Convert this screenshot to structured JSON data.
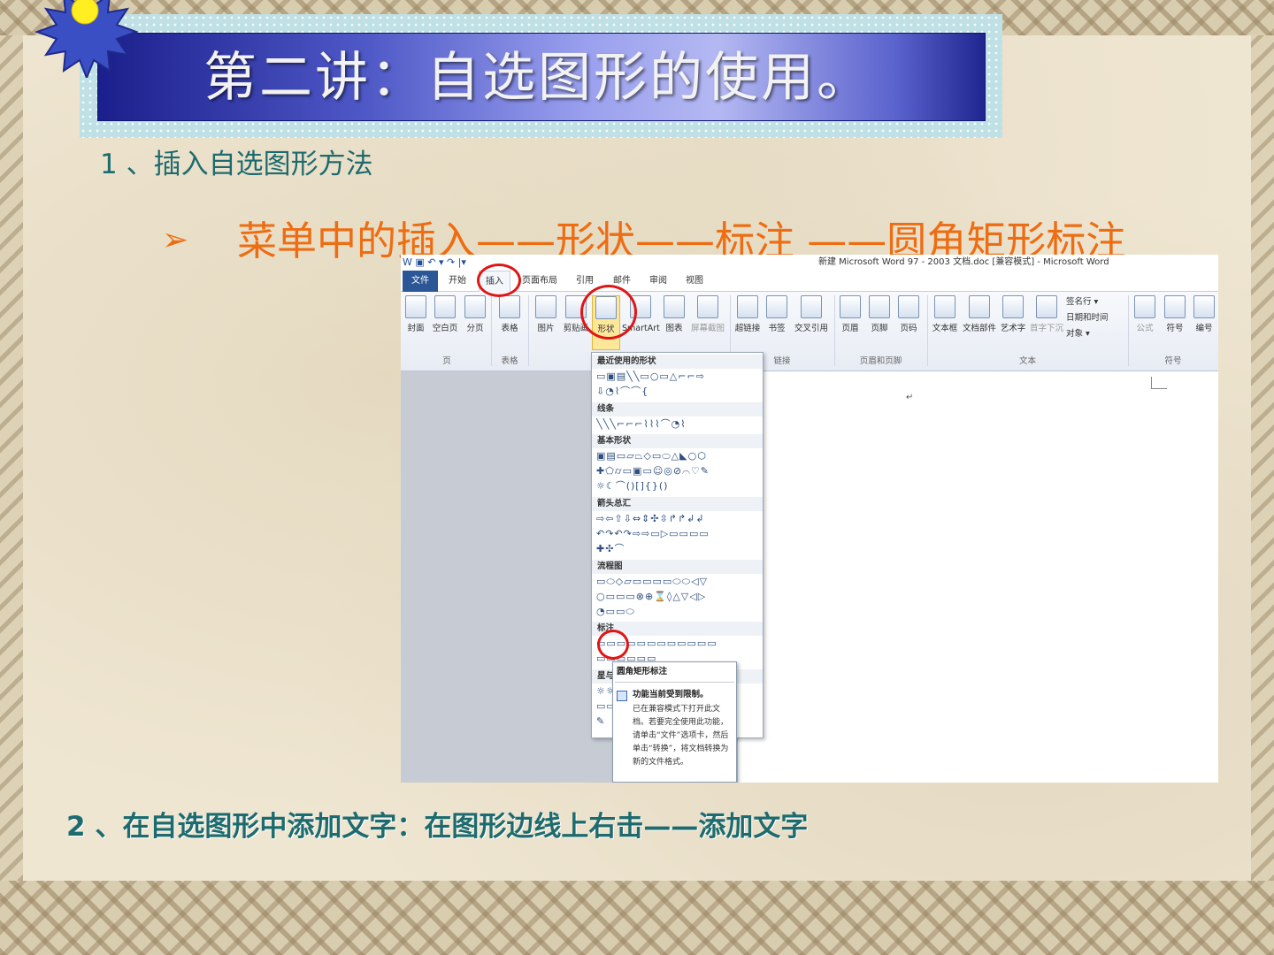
{
  "slide": {
    "title": "第二讲：自选图形的使用。",
    "heading1": "1 、插入自选图形方法",
    "bullet_marker": "➢",
    "bullet_text": "菜单中的插入——形状——标注 ——圆角矩形标注",
    "heading2": "2 、在自选图形中添加文字：在图形边线上右击——添加文字"
  },
  "word": {
    "window_title": "新建 Microsoft Word 97 - 2003 文档.doc [兼容模式] - Microsoft Word",
    "quick_access": "W  ▣  ↶ ▾  ↷  |▾",
    "tabs": [
      "文件",
      "开始",
      "插入",
      "页面布局",
      "引用",
      "邮件",
      "审阅",
      "视图"
    ],
    "active_tab": "插入",
    "ribbon_buttons": [
      "封面",
      "空白页",
      "分页",
      "表格",
      "图片",
      "剪贴画",
      "形状",
      "SmartArt",
      "图表",
      "屏幕截图",
      "超链接",
      "书签",
      "交叉引用",
      "页眉",
      "页脚",
      "页码",
      "文本框",
      "文档部件",
      "艺术字",
      "首字下沉",
      "公式",
      "符号",
      "编号"
    ],
    "small_buttons": [
      "签名行 ▾",
      "日期和时间",
      "对象 ▾"
    ],
    "groups": [
      "页",
      "表格",
      "链接",
      "页眉和页脚",
      "文本",
      "符号"
    ],
    "highlighted_button": "形状",
    "paragraph_mark": "↵"
  },
  "shapes_menu": {
    "sections": [
      "最近使用的形状",
      "线条",
      "基本形状",
      "箭头总汇",
      "流程图",
      "标注",
      "星与"
    ],
    "rows": [
      "▭▣▤╲╲▭○▭△⌐⌐⇨",
      "⇩◔⌇⌒⌒{",
      "╲╲╲⌐⌐⌐⌇⌇⌇⌒◔⌇",
      "▣▤▭▱⏢◇▭⬭△◣○⬡",
      "✚⬠⌭▭▣▭☺◎⊘⌒♡✎",
      "☼☾⌒()[]{}()",
      "⇨⇦⇧⇩⇔⇕✣⇳↱↱↲↲",
      "↶↷↶↷⇨⇨▭▷▭▭▭▭",
      "✚✣⌒",
      "▭⬭◇▱▭▭▭▭⬭⬭◁▽",
      "○▭▭▭⊗⊕⌛◊△▽◁▷",
      "◔▭▭⬭",
      "▭▭▭▭▭▭▭▭▭▭▭▭",
      "▭▭▭▭▭▭",
      "☼☼",
      "▭▭",
      "✎"
    ]
  },
  "tooltip": {
    "title": "圆角矩形标注",
    "heading": "功能当前受到限制。",
    "body": "已在兼容模式下打开此文档。若要完全使用此功能，请单击“文件”选项卡，然后单击“转换”，将文档转换为新的文件格式。"
  },
  "colors": {
    "heading_teal": "#1d6b6e",
    "accent_orange": "#ee6d12",
    "annotation_red": "#e01515",
    "title_blue": "#1b1f8c"
  }
}
